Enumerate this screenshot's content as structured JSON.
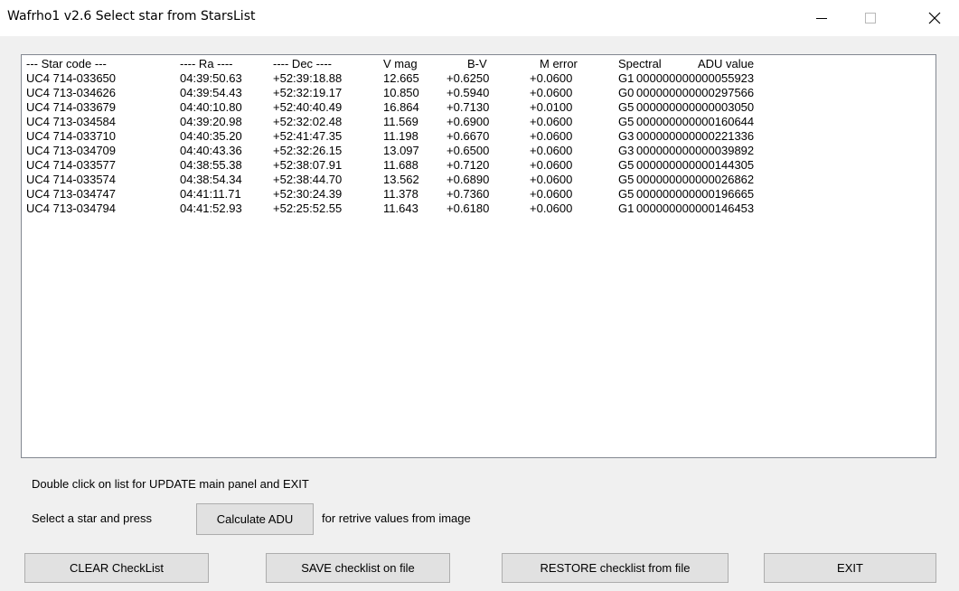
{
  "window": {
    "title": "Wafrho1 v2.6 Select star from StarsList",
    "controls": [
      "minimize-icon",
      "maximize-icon",
      "close-icon"
    ]
  },
  "list": {
    "header": {
      "code": "--- Star code ---",
      "ra": "---- Ra ----",
      "dec": "---- Dec ----",
      "vmag": "V mag",
      "bv": "B-V",
      "merr": "M error",
      "spec": "Spectral",
      "adu": "ADU value"
    },
    "rows": [
      {
        "code": "UC4 714-033650",
        "ra": "04:39:50.63",
        "dec": "+52:39:18.88",
        "vmag": "12.665",
        "bv": "+0.6250",
        "merr": "+0.0600",
        "spec": "G1",
        "adu": "000000000000055923"
      },
      {
        "code": "UC4 713-034626",
        "ra": "04:39:54.43",
        "dec": "+52:32:19.17",
        "vmag": "10.850",
        "bv": "+0.5940",
        "merr": "+0.0600",
        "spec": "G0",
        "adu": "000000000000297566"
      },
      {
        "code": "UC4 714-033679",
        "ra": "04:40:10.80",
        "dec": "+52:40:40.49",
        "vmag": "16.864",
        "bv": "+0.7130",
        "merr": "+0.0100",
        "spec": "G5",
        "adu": "000000000000003050"
      },
      {
        "code": "UC4 713-034584",
        "ra": "04:39:20.98",
        "dec": "+52:32:02.48",
        "vmag": "11.569",
        "bv": "+0.6900",
        "merr": "+0.0600",
        "spec": "G5",
        "adu": "000000000000160644"
      },
      {
        "code": "UC4 714-033710",
        "ra": "04:40:35.20",
        "dec": "+52:41:47.35",
        "vmag": "11.198",
        "bv": "+0.6670",
        "merr": "+0.0600",
        "spec": "G3",
        "adu": "000000000000221336"
      },
      {
        "code": "UC4 713-034709",
        "ra": "04:40:43.36",
        "dec": "+52:32:26.15",
        "vmag": "13.097",
        "bv": "+0.6500",
        "merr": "+0.0600",
        "spec": "G3",
        "adu": "000000000000039892"
      },
      {
        "code": "UC4 714-033577",
        "ra": "04:38:55.38",
        "dec": "+52:38:07.91",
        "vmag": "11.688",
        "bv": "+0.7120",
        "merr": "+0.0600",
        "spec": "G5",
        "adu": "000000000000144305"
      },
      {
        "code": "UC4 714-033574",
        "ra": "04:38:54.34",
        "dec": "+52:38:44.70",
        "vmag": "13.562",
        "bv": "+0.6890",
        "merr": "+0.0600",
        "spec": "G5",
        "adu": "000000000000026862"
      },
      {
        "code": "UC4 713-034747",
        "ra": "04:41:11.71",
        "dec": "+52:30:24.39",
        "vmag": "11.378",
        "bv": "+0.7360",
        "merr": "+0.0600",
        "spec": "G5",
        "adu": "000000000000196665"
      },
      {
        "code": "UC4 713-034794",
        "ra": "04:41:52.93",
        "dec": "+52:25:52.55",
        "vmag": "11.643",
        "bv": "+0.6180",
        "merr": "+0.0600",
        "spec": "G1",
        "adu": "000000000000146453"
      }
    ]
  },
  "hint": {
    "double_click": "Double click on list for UPDATE main panel and EXIT",
    "select_star": "Select a star and press",
    "retrieve": "for retrive values from image"
  },
  "buttons": {
    "calculate_adu": "Calculate ADU",
    "clear": "CLEAR CheckList",
    "save": "SAVE checklist on file",
    "restore": "RESTORE checklist from  file",
    "exit": "EXIT"
  }
}
